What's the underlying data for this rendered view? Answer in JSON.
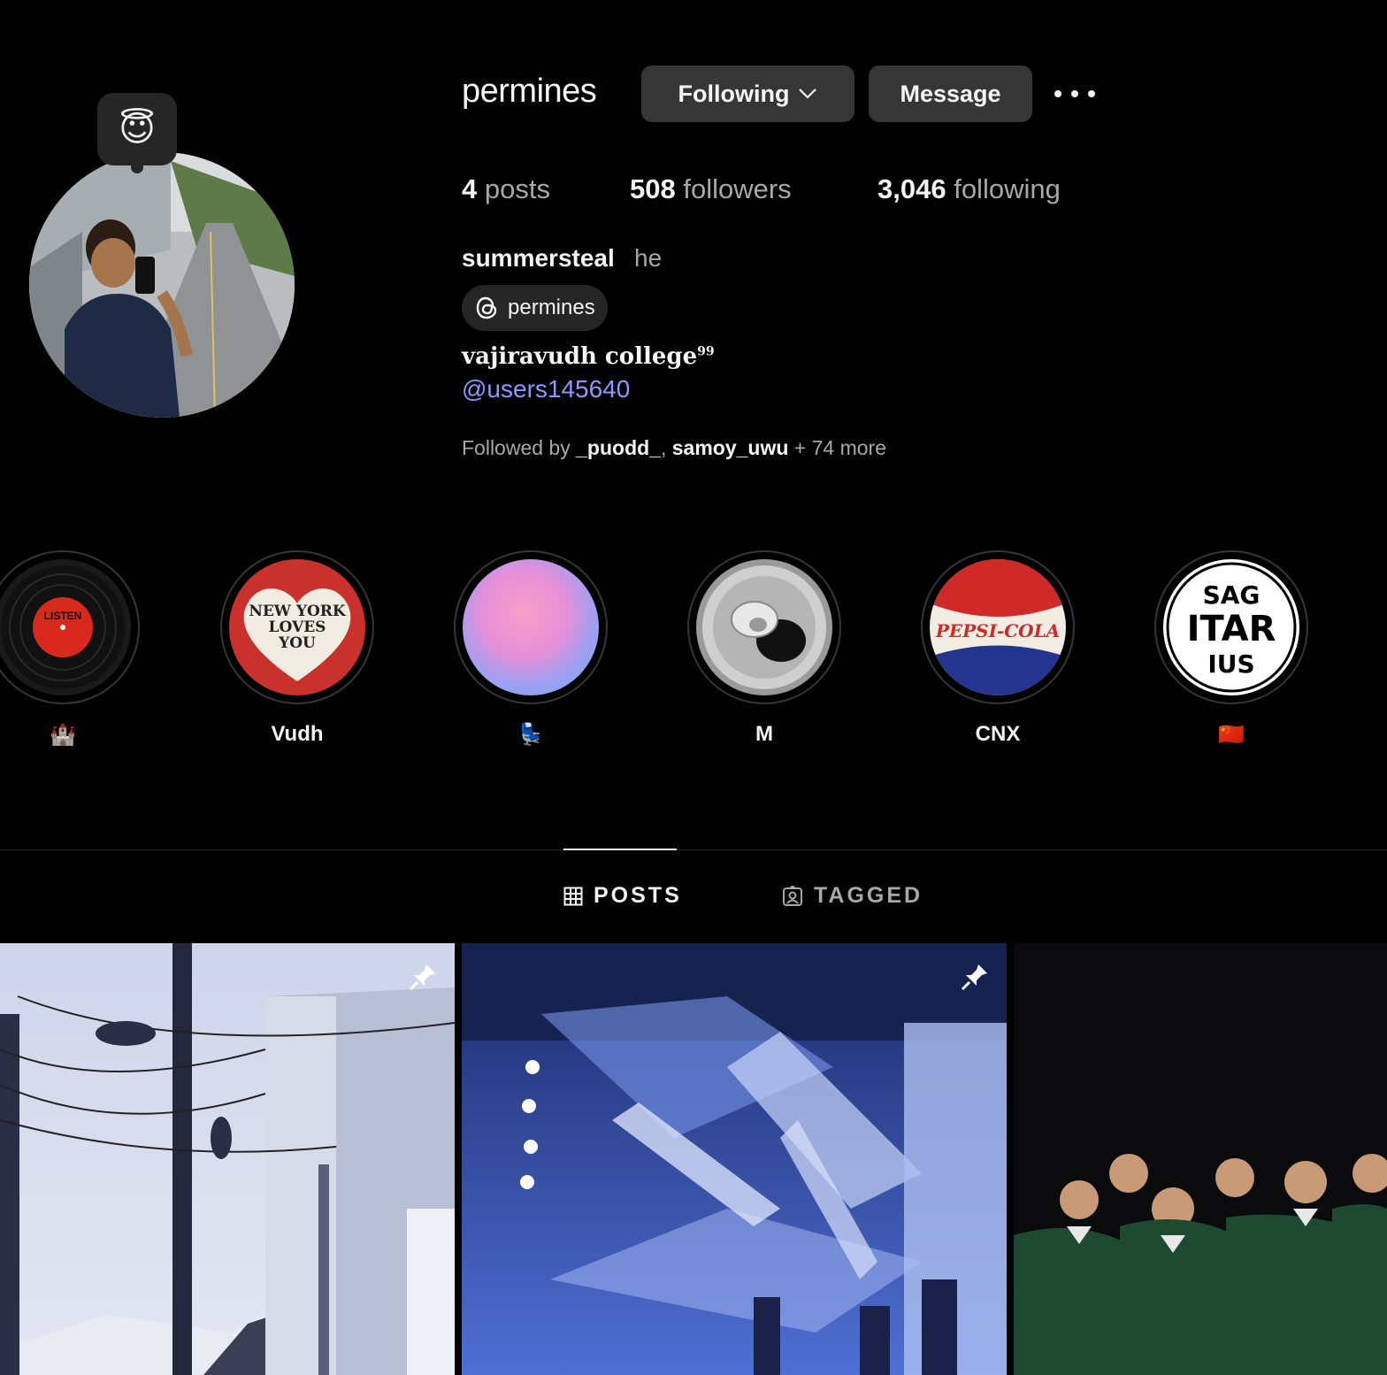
{
  "profile": {
    "username": "permines",
    "note_emoji": "😇",
    "following_label": "Following",
    "message_label": "Message",
    "stats": {
      "posts_count": "4",
      "posts_label": "posts",
      "followers_count": "508",
      "followers_label": "followers",
      "following_count": "3,046",
      "following_label": "following"
    },
    "full_name": "summersteal",
    "pronoun": "he",
    "threads_handle": "permines",
    "bio_text": "vajiravudh college",
    "bio_sup": "99",
    "bio_link": "@users145640",
    "followed_by": {
      "prefix": "Followed by",
      "user1": "_puodd_",
      "sep": ",",
      "user2": "samoy_uwu",
      "more": "+ 74 more"
    }
  },
  "highlights": [
    {
      "label": "🏰",
      "cover": "record-listen"
    },
    {
      "label": "Vudh",
      "cover": "new-york-heart",
      "cover_text": [
        "NEW YORK",
        "LOVES",
        "YOU"
      ]
    },
    {
      "label": "💺",
      "cover": "pink-gradient"
    },
    {
      "label": "M",
      "cover": "soda-can-top"
    },
    {
      "label": "CNX",
      "cover": "pepsi-cola-logo",
      "cover_text": [
        "PEPSI-COLA"
      ]
    },
    {
      "label": "🇨🇳",
      "cover": "sagittarius-logo",
      "cover_text": [
        "SAG",
        "ITAR",
        "IUS"
      ]
    }
  ],
  "tabs": [
    {
      "label": "POSTS",
      "icon": "grid-icon",
      "active": true
    },
    {
      "label": "TAGGED",
      "icon": "tagged-icon",
      "active": false
    }
  ],
  "posts": [
    {
      "subject": "utility-poles-building",
      "pinned": true
    },
    {
      "subject": "concert-stage-lights",
      "pinned": true
    },
    {
      "subject": "group-photo-night",
      "pinned": false
    }
  ],
  "colors": {
    "background": "#000000",
    "button": "#363636",
    "text_primary": "#f5f5f5",
    "text_secondary": "#a8a8a8",
    "link": "#8c9aff"
  }
}
